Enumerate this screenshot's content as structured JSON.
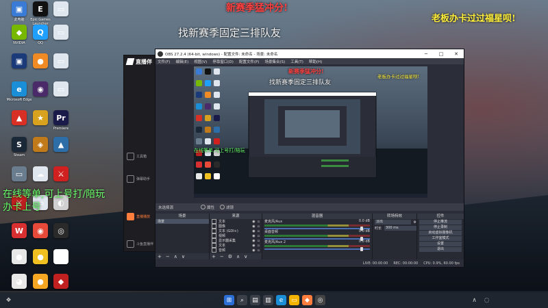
{
  "overlay": {
    "top_red": "新赛季猛冲分!",
    "top_yellow": "老板办卡过过福星呗!",
    "top_white": "找新赛季固定三排队友",
    "green_line1": "在线等单,可上号打/陪玩",
    "green_line2": "办卡上号"
  },
  "desktop_icons": [
    {
      "label": "此电脑",
      "color": "#3a7bd5",
      "glyph": "▣"
    },
    {
      "label": "Epic Games Launcher",
      "color": "#111111",
      "glyph": "E"
    },
    {
      "label": "",
      "color": "#dfe6ee",
      "glyph": "▭"
    },
    {
      "label": "NVIDIA",
      "color": "#76b900",
      "glyph": "◆"
    },
    {
      "label": "QQ",
      "color": "#1fa0ff",
      "glyph": "Q"
    },
    {
      "label": "",
      "color": "#dfe6ee",
      "glyph": "▭"
    },
    {
      "label": "",
      "color": "#1a3a7a",
      "glyph": "▣"
    },
    {
      "label": "",
      "color": "#f08a24",
      "glyph": "●"
    },
    {
      "label": "",
      "color": "#dfe6ee",
      "glyph": "▭"
    },
    {
      "label": "Microsoft Edge",
      "color": "#1a8fd8",
      "glyph": "e"
    },
    {
      "label": "",
      "color": "#4b2a6a",
      "glyph": "◉"
    },
    {
      "label": "",
      "color": "#dfe6ee",
      "glyph": "▭"
    },
    {
      "label": "",
      "color": "#d93025",
      "glyph": "▲"
    },
    {
      "label": "",
      "color": "#d8a11e",
      "glyph": "★"
    },
    {
      "label": "Premiere",
      "color": "#1b1b4a",
      "glyph": "Pr"
    },
    {
      "label": "Steam",
      "color": "#1b2838",
      "glyph": "S"
    },
    {
      "label": "",
      "color": "#c07a1a",
      "glyph": "◈"
    },
    {
      "label": "",
      "color": "#2e6ea8",
      "glyph": "▲"
    },
    {
      "label": "",
      "color": "#6a7d8f",
      "glyph": "▭"
    },
    {
      "label": "",
      "color": "#dfe6ee",
      "glyph": "☁"
    },
    {
      "label": "",
      "color": "#d02020",
      "glyph": "⚔"
    },
    {
      "label": "",
      "color": "#c02020",
      "glyph": "⚔"
    },
    {
      "label": "",
      "color": "#dfe6ee",
      "glyph": "▭"
    },
    {
      "label": "",
      "color": "#d0d0d0",
      "glyph": "◐"
    },
    {
      "label": "",
      "color": "#d83030",
      "glyph": "W"
    },
    {
      "label": "",
      "color": "#e84a3a",
      "glyph": "◉"
    },
    {
      "label": "",
      "color": "#2a2a2a",
      "glyph": "◎"
    },
    {
      "label": "",
      "color": "#e8e8e8",
      "glyph": "●"
    },
    {
      "label": "",
      "color": "#f0c020",
      "glyph": "●"
    },
    {
      "label": "",
      "color": "#ffffff",
      "glyph": "◔"
    },
    {
      "label": "",
      "color": "#e8e8e8",
      "glyph": "◕"
    },
    {
      "label": "",
      "color": "#f5a623",
      "glyph": "●"
    },
    {
      "label": "",
      "color": "#c02020",
      "glyph": "◆"
    }
  ],
  "streamer_app": {
    "logo": "直播伴",
    "nav": [
      {
        "label": "工具箱",
        "active": false
      },
      {
        "label": "弹幕助手",
        "active": false
      },
      {
        "label": "直播播放",
        "active": true
      },
      {
        "label": "斗鱼直播伴",
        "active": false
      }
    ]
  },
  "obs": {
    "title": "OBS 27.2.4 (64-bit, windows) - 配置文件: 未命名 - 场景: 未命名",
    "menu": [
      "文件(F)",
      "编辑(E)",
      "视图(V)",
      "停靠窗口(D)",
      "配置文件(P)",
      "场景集合(S)",
      "工具(T)",
      "帮助(H)"
    ],
    "nested_overlay": {
      "red": "新赛季猛冲分!",
      "yellow": "老板办卡过过福星呗!",
      "white": "找新赛季固定三排队友",
      "green": "在线等单,可上号打/陪玩"
    },
    "mode_bar": {
      "source_label": "未选择源",
      "properties": "属性",
      "filters": "滤镜"
    },
    "docks": {
      "scenes": {
        "title": "场景",
        "items": [
          "场景"
        ]
      },
      "sources": {
        "title": "来源",
        "items": [
          "文本",
          "图像",
          "文本 (GDI+)",
          "视频",
          "显示器采集",
          "文本",
          "音频"
        ]
      },
      "mixer": {
        "title": "混音器",
        "channels": [
          {
            "name": "麦克风/Aux",
            "level": "0.0 dB"
          },
          {
            "name": "桌面音频",
            "level": "0.0 dB"
          },
          {
            "name": "麦克风/Aux 2",
            "level": "0.0 dB"
          }
        ]
      },
      "transitions": {
        "title": "转场特效",
        "type": "淡出",
        "duration_label": "时长",
        "duration": "300 ms"
      },
      "controls": {
        "title": "控件",
        "buttons": [
          "停止推流",
          "停止录制",
          "启动虚拟摄像机",
          "工作室模式",
          "设置",
          "退出"
        ]
      }
    },
    "status": {
      "live": "LIVE: 00:00:00",
      "rec": "REC: 00:00:00",
      "cpu": "CPU: 0.9%, 60.00 fps"
    }
  }
}
